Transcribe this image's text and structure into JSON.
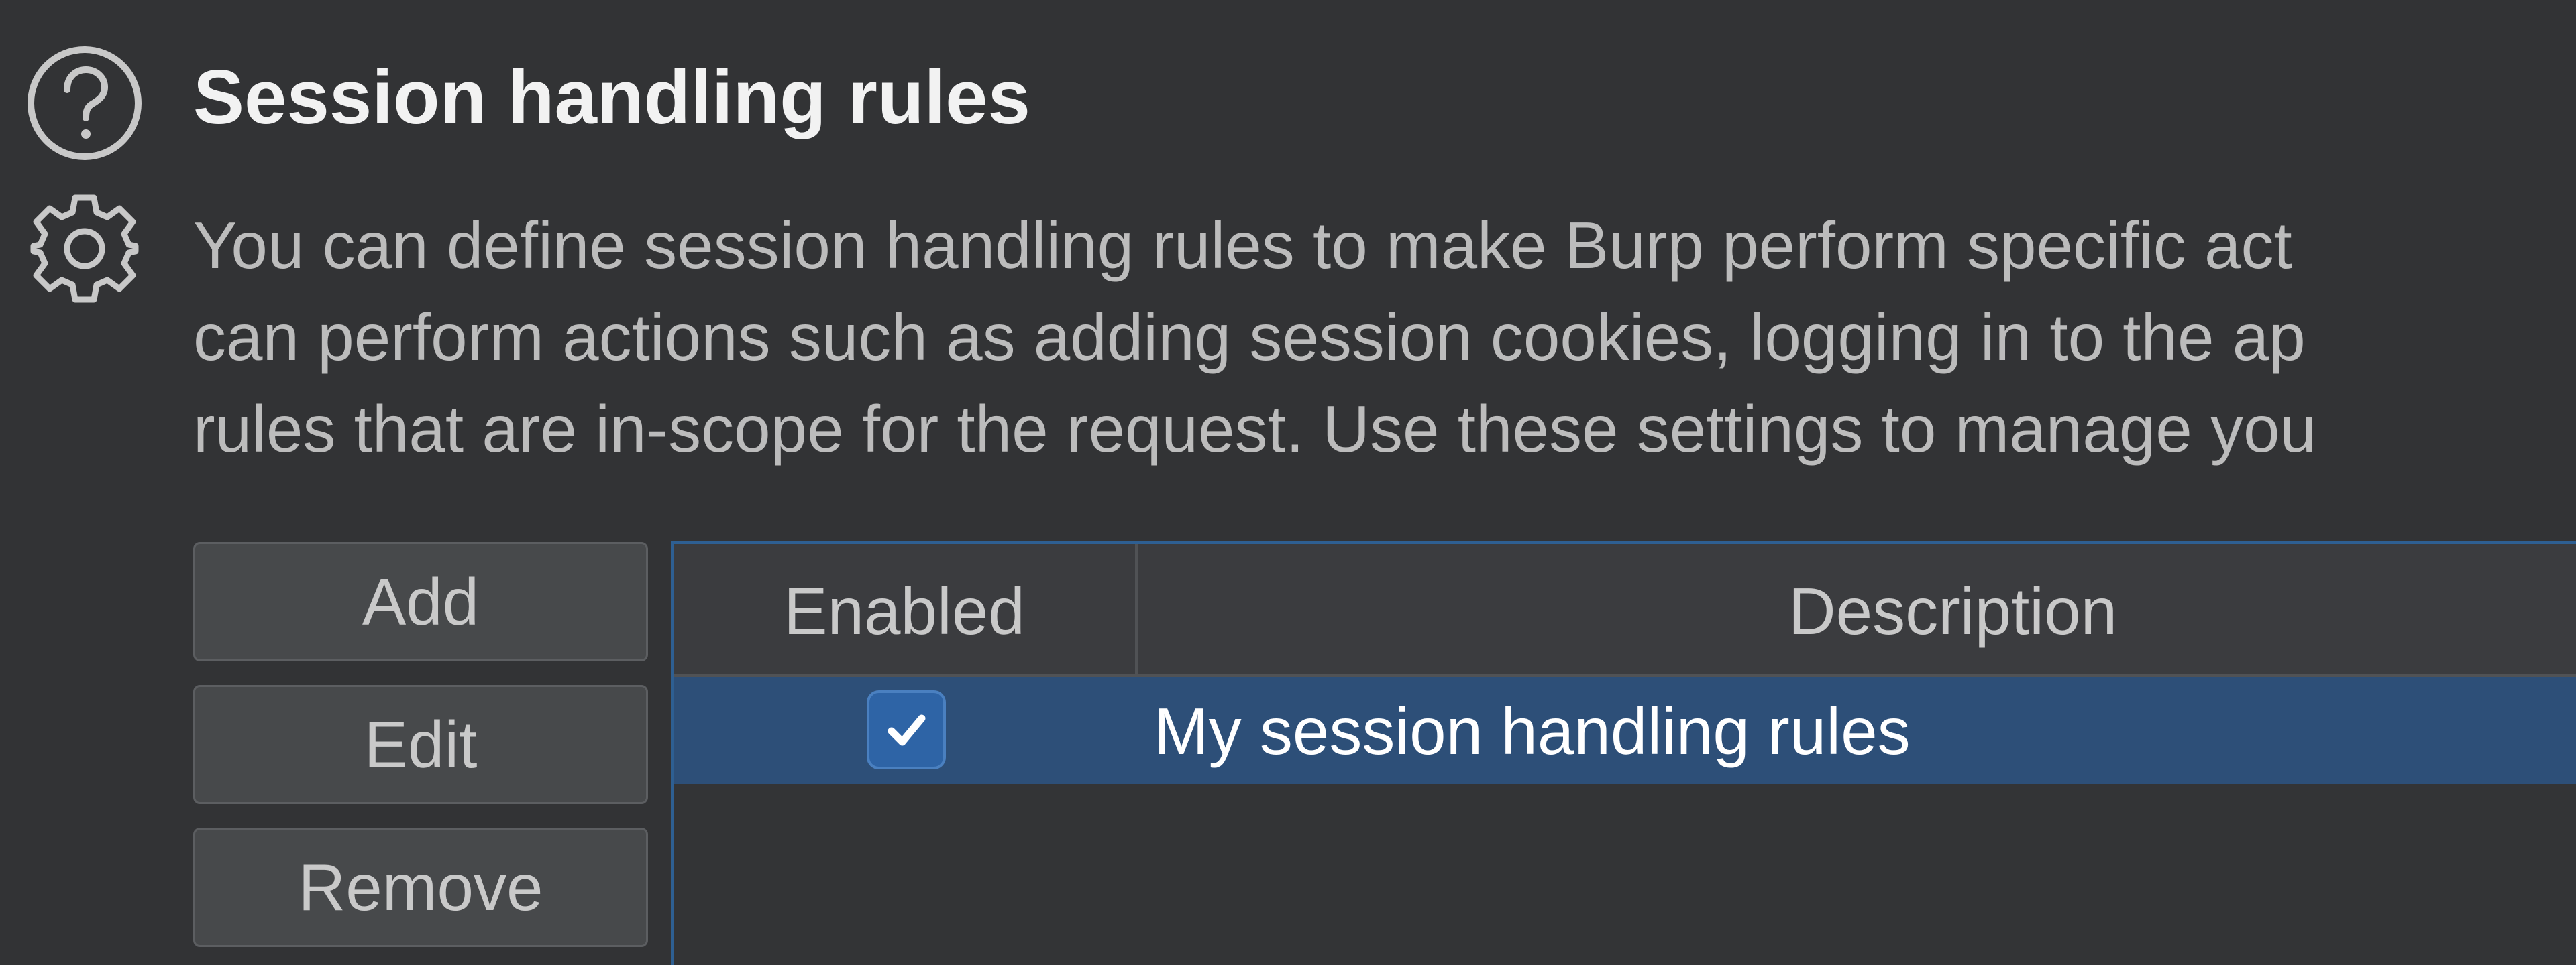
{
  "section": {
    "title": "Session handling rules",
    "description_lines": [
      "You can define session handling rules to make Burp perform specific act",
      "can perform actions such as adding session cookies, logging in to the ap",
      "rules that are in-scope for the request. Use these settings to manage you"
    ],
    "icons": [
      "help-circle-icon",
      "gear-icon"
    ]
  },
  "buttons": {
    "add": "Add",
    "edit": "Edit",
    "remove": "Remove"
  },
  "table": {
    "columns": [
      "Enabled",
      "Description"
    ],
    "rows": [
      {
        "enabled": true,
        "description": "My session handling rules",
        "selected": true
      }
    ]
  },
  "colors": {
    "background": "#323335",
    "selection": "#2d4f78",
    "checkbox_accent": "#2e64a6",
    "table_focus_border": "#2e5f92"
  }
}
